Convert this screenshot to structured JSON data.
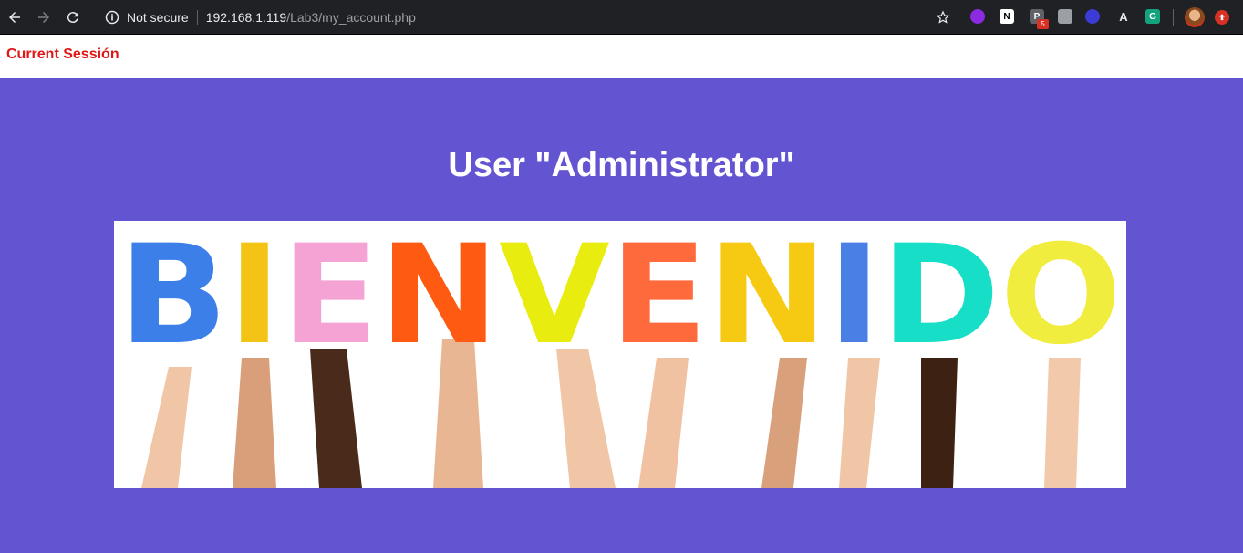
{
  "browser": {
    "security_label": "Not secure",
    "url_host": "192.168.1.119",
    "url_path": "/Lab3/my_account.php",
    "extension_badge": "5",
    "extensions": [
      "P",
      "G"
    ]
  },
  "page": {
    "session_link": "Current Sessión",
    "user_heading": "User \"Administrator\"",
    "banner_text": "BIENVENIDO"
  },
  "colors": {
    "background": "#6355d1",
    "session_link": "#e01717",
    "letters": [
      "#3d7fe8",
      "#f3c316",
      "#f4a3d4",
      "#ff5a12",
      "#e8ed0f",
      "#ff6a3d",
      "#f6c913",
      "#4a7fe6",
      "#17dfc7",
      "#f0ed3f"
    ]
  }
}
